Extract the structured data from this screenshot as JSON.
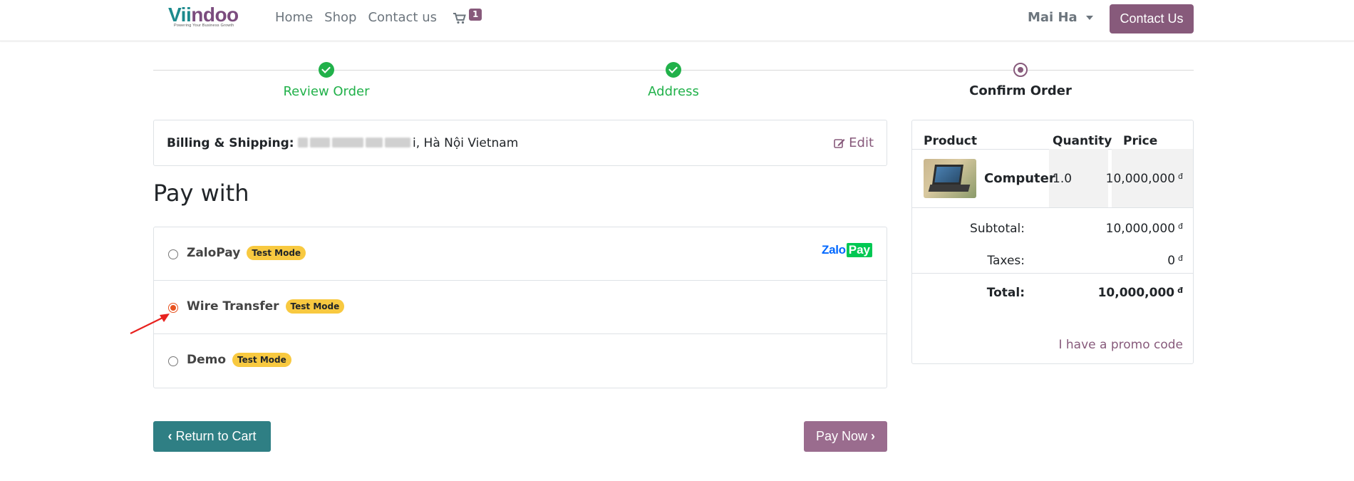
{
  "header": {
    "logo_text_part1": "Vii",
    "logo_text_part2": "ndoo",
    "logo_tagline": "Powering Your Business Growth",
    "nav": [
      "Home",
      "Shop",
      "Contact us"
    ],
    "cart_count": "1",
    "user_name": "Mai Ha",
    "contact_button": "Contact Us"
  },
  "progress": {
    "steps": [
      {
        "label": "Review Order",
        "state": "done"
      },
      {
        "label": "Address",
        "state": "done"
      },
      {
        "label": "Confirm Order",
        "state": "current"
      }
    ]
  },
  "billing": {
    "label": "Billing & Shipping:",
    "address_visible": "i, Hà Nội Vietnam",
    "edit_label": "Edit"
  },
  "pay_with_title": "Pay with",
  "payment_methods": [
    {
      "name": "ZaloPay",
      "badge": "Test Mode",
      "checked": false,
      "logo_a": "Zalo",
      "logo_b": "Pay"
    },
    {
      "name": "Wire Transfer",
      "badge": "Test Mode",
      "checked": true
    },
    {
      "name": "Demo",
      "badge": "Test Mode",
      "checked": false
    }
  ],
  "buttons": {
    "return_to_cart": "Return to Cart",
    "pay_now": "Pay Now"
  },
  "summary": {
    "columns": [
      "Product",
      "Quantity",
      "Price"
    ],
    "product": {
      "name": "Computer",
      "quantity": "1.0",
      "price": "10,000,000",
      "currency": "đ"
    },
    "subtotal_label": "Subtotal:",
    "subtotal_value": "10,000,000",
    "taxes_label": "Taxes:",
    "taxes_value": "0",
    "total_label": "Total:",
    "total_value": "10,000,000",
    "currency": "đ",
    "promo_link": "I have a promo code"
  },
  "colors": {
    "brand": "#875a7b",
    "teal": "#2f7f84",
    "success": "#21b14a",
    "badge": "#f8c940",
    "annotation_arrow": "#e8211e"
  }
}
